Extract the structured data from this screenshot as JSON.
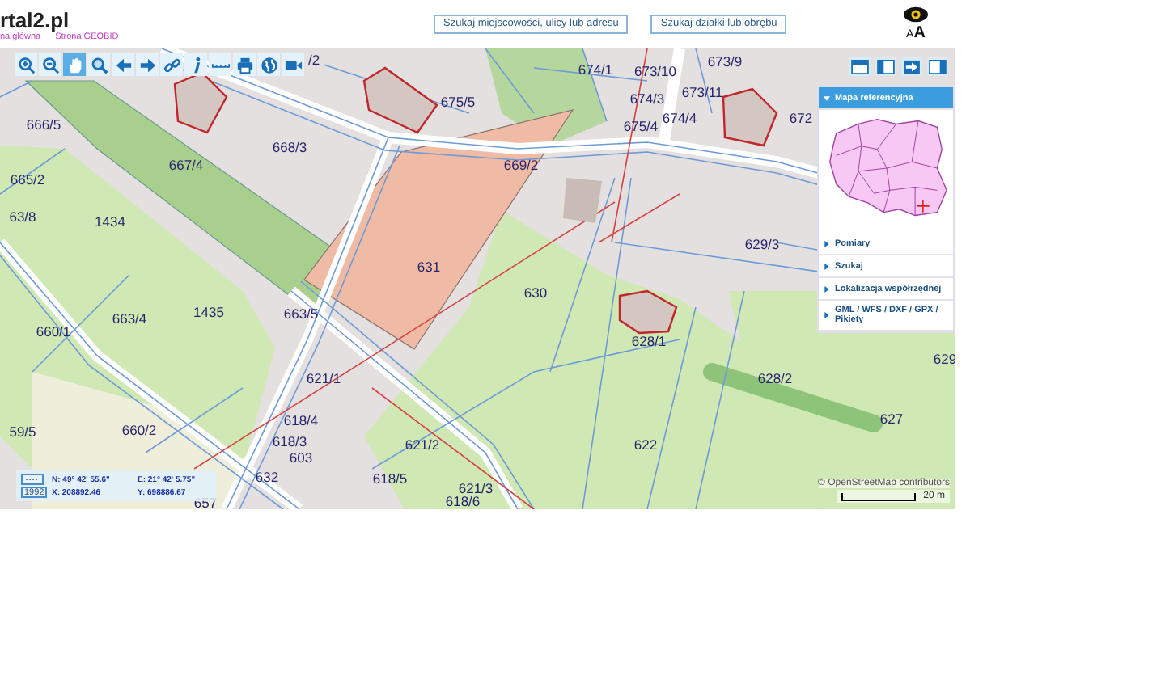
{
  "header": {
    "title": "rtal2.pl",
    "links": [
      "na główna",
      "Strona GEOBID"
    ],
    "search_buttons": [
      "Szukaj miejscowości, ulicy lub adresu",
      "Szukaj działki lub obrębu"
    ],
    "font_size_label": {
      "small": "A",
      "large": "A"
    }
  },
  "toolbar": {
    "tools": [
      {
        "kind": "zoom-in",
        "selected": false
      },
      {
        "kind": "zoom-out",
        "selected": false
      },
      {
        "kind": "pan",
        "selected": true
      },
      {
        "kind": "zoom-box",
        "selected": false
      },
      {
        "kind": "back",
        "selected": false
      },
      {
        "kind": "forward",
        "selected": false
      },
      {
        "kind": "link",
        "selected": false
      },
      {
        "kind": "info",
        "selected": false
      },
      {
        "kind": "measure",
        "selected": false
      },
      {
        "kind": "print",
        "selected": false
      },
      {
        "kind": "globe",
        "selected": false
      },
      {
        "kind": "camera",
        "selected": false
      }
    ]
  },
  "layout_buttons": [
    {
      "kind": "top"
    },
    {
      "kind": "left"
    },
    {
      "kind": "arrow"
    },
    {
      "kind": "right"
    }
  ],
  "parcels": [
    "/2",
    "674/1",
    "673/10",
    "673/9",
    "675/5",
    "674/3",
    "673/11",
    "672",
    "666/5",
    "667/4",
    "668/3",
    "675/4",
    "674/4",
    "669/2",
    "665/2",
    "63/8",
    "1434",
    "631",
    "629/3",
    "630",
    "663/4",
    "1435",
    "663/5",
    "660/1",
    "628/1",
    "621/1",
    "628/2",
    "629",
    "59/5",
    "660/2",
    "618/4",
    "627",
    "618/3",
    "621/2",
    "622",
    "603",
    "632",
    "618/5",
    "621/3",
    "618/6",
    "657"
  ],
  "side_panel": {
    "sections": [
      {
        "label": "Mapa referencyjna",
        "expanded": true
      },
      {
        "label": "Pomiary",
        "expanded": false
      },
      {
        "label": "Szukaj",
        "expanded": false
      },
      {
        "label": "Lokalizacja współrzędnej",
        "expanded": false
      },
      {
        "label": "GML / WFS / DXF / GPX / Pikiety",
        "expanded": false
      }
    ]
  },
  "coordinates": {
    "system": "1992",
    "n": "N: 49° 42' 55.6\"",
    "e": "E: 21° 42' 5.75\"",
    "x": "X: 208892.46",
    "y": "Y: 698886.67"
  },
  "attribution": "© OpenStreetMap contributors",
  "scale": "20 m"
}
